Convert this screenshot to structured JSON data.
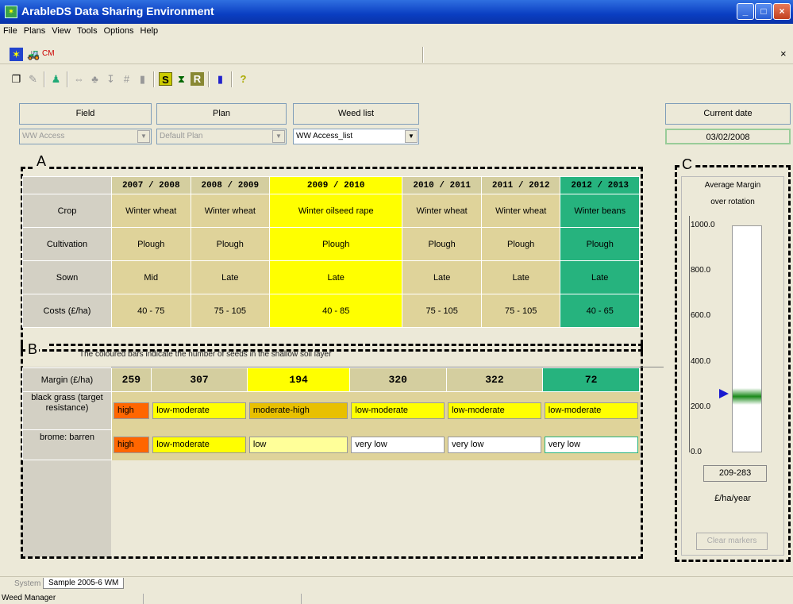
{
  "window": {
    "title": "ArableDS Data Sharing Environment"
  },
  "menu": [
    "File",
    "Plans",
    "View",
    "Tools",
    "Options",
    "Help"
  ],
  "toolbar1": {
    "cm_label": "CM",
    "close": "×"
  },
  "selectors": {
    "field_label": "Field",
    "field_value": "WW Access",
    "plan_label": "Plan",
    "plan_value": "Default Plan",
    "weed_label": "Weed list",
    "weed_value": "WW Access_list",
    "date_label": "Current date",
    "date_value": "03/02/2008"
  },
  "section_a": {
    "label": "A",
    "years": [
      "2007 / 2008",
      "2008 / 2009",
      "2009 / 2010",
      "2010 / 2011",
      "2011 / 2012",
      "2012 / 2013"
    ],
    "rows": [
      {
        "label": "Crop",
        "values": [
          "Winter wheat",
          "Winter wheat",
          "Winter oilseed rape",
          "Winter wheat",
          "Winter wheat",
          "Winter beans"
        ]
      },
      {
        "label": "Cultivation",
        "values": [
          "Plough",
          "Plough",
          "Plough",
          "Plough",
          "Plough",
          "Plough"
        ]
      },
      {
        "label": "Sown",
        "values": [
          "Mid",
          "Late",
          "Late",
          "Late",
          "Late",
          "Late"
        ]
      },
      {
        "label": "Costs  (£/ha)",
        "values": [
          "40 - 75",
          "75 - 105",
          "40 - 85",
          "75 - 105",
          "75 - 105",
          "40 - 65"
        ]
      }
    ],
    "col_colors": [
      "#dfd39a",
      "#dfd39a",
      "#ffff00",
      "#dfd39a",
      "#dfd39a",
      "#26b37e"
    ]
  },
  "section_b": {
    "label": "B",
    "note": "The coloured bars indicate the number of seeds in the shallow soil layer",
    "margin_label": "Margin (£/ha)",
    "margins": [
      "259",
      "307",
      "194",
      "320",
      "322",
      "72"
    ],
    "weeds": [
      {
        "label": "black grass (target resistance)",
        "values": [
          "high",
          "low-moderate",
          "moderate-high",
          "low-moderate",
          "low-moderate",
          "low-moderate"
        ],
        "colors": [
          "#ff6600",
          "#ffff00",
          "#e8c000",
          "#ffff00",
          "#ffff00",
          "#ffff00"
        ]
      },
      {
        "label": "brome: barren",
        "values": [
          "high",
          "low-moderate",
          "low",
          "very low",
          "very low",
          "very low"
        ],
        "colors": [
          "#ff6600",
          "#ffff00",
          "#ffff99",
          "#ffffff",
          "#ffffff",
          "#ffffff"
        ]
      }
    ]
  },
  "section_c": {
    "label": "C",
    "title1": "Average Margin",
    "title2": "over rotation",
    "ticks": [
      "1000.0",
      "800.0",
      "600.0",
      "400.0",
      "200.0",
      "0.0"
    ],
    "marker_value": 259,
    "band": [
      209,
      283
    ],
    "range_text": "209-283",
    "unit": "£/ha/year",
    "clear_button": "Clear markers"
  },
  "tabs": {
    "system": "System",
    "sample": "Sample 2005-6 WM"
  },
  "status": "Weed Manager"
}
